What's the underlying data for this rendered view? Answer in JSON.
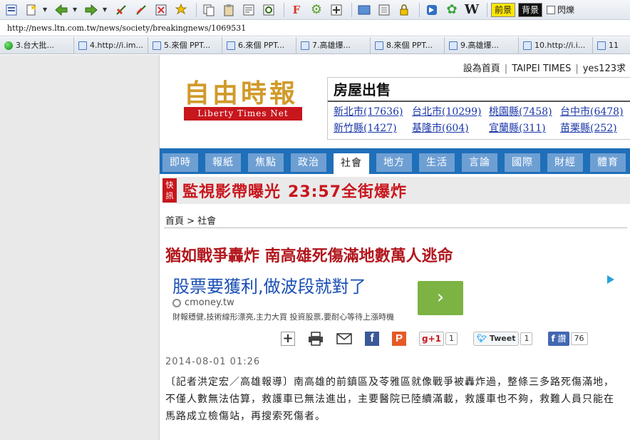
{
  "browser": {
    "toolbar_icons": [
      "home-icon",
      "new-page-icon",
      "back-icon",
      "forward-icon",
      "refresh-icon",
      "stop-icon",
      "close-tab-icon",
      "favorite-pin-icon",
      "copy-icon",
      "paste-icon",
      "edit-icon",
      "find-icon",
      "font-icon",
      "gear-icon",
      "move-icon",
      "window-icon",
      "download-icon",
      "lock-icon",
      "mail-icon",
      "flower-icon"
    ],
    "wiki_label": "W",
    "front_label": "前景",
    "back_label": "背景",
    "flash_label": "閃爍",
    "address": "http://news.ltn.com.tw/news/society/breakingnews/1069531",
    "tabs": [
      {
        "label": "3.台大批...",
        "icon": "green-dot"
      },
      {
        "label": "4.http://i.im...",
        "icon": "page"
      },
      {
        "label": "5.來個 PPT...",
        "icon": "page"
      },
      {
        "label": "6.來個 PPT...",
        "icon": "page"
      },
      {
        "label": "7.高雄爆...",
        "icon": "page"
      },
      {
        "label": "8.來個 PPT...",
        "icon": "page"
      },
      {
        "label": "9.高雄爆...",
        "icon": "page"
      },
      {
        "label": "10.http://i.i...",
        "icon": "page"
      },
      {
        "label": "11",
        "icon": "page"
      }
    ]
  },
  "site": {
    "top_links": [
      "設為首頁",
      "TAIPEI TIMES",
      "yes123求"
    ],
    "logo_cn": "自由時報",
    "logo_en": "Liberty Times Net",
    "house": {
      "title": "房屋出售",
      "links": [
        "新北市(17636)",
        "台北市(10299)",
        "桃園縣(7458)",
        "台中市(6478)",
        "新竹縣(1427)",
        "基隆市(604)",
        "宜蘭縣(311)",
        "苗栗縣(252)"
      ]
    },
    "nav": [
      "即時",
      "報紙",
      "焦點",
      "政治",
      "社會",
      "地方",
      "生活",
      "言論",
      "國際",
      "財經",
      "體育"
    ],
    "nav_active_index": 4,
    "breaking": {
      "tag": "快訊",
      "text_before": "監視影帶曝光",
      "time": "23:57",
      "text_after": "全街爆炸"
    },
    "breadcrumb": "首頁 > 社會",
    "headline": "猶如戰爭轟炸 南高雄死傷滿地數萬人逃命",
    "ad": {
      "title": "股票要獲利,做波段就對了",
      "site": "cmoney.tw",
      "desc": "財報穩健,技術線形漂亮,主力大買 投資股票,要耐心等待上漲時機",
      "button": "›"
    },
    "share": {
      "gplus_label": "g+1",
      "gplus_count": "1",
      "tweet_label": "Tweet",
      "tweet_count": "1",
      "like_label": "讚",
      "like_count": "76"
    },
    "date": "2014-08-01  01:26",
    "body": "〔記者洪定宏／高雄報導〕南高雄的前鎮區及苓雅區就像戰爭被轟炸過，整條三多路死傷滿地，不僅人數無法估算，救護車已無法進出，主要醫院已陸續滿載，救護車也不夠，救難人員只能在馬路成立檢傷站，再搜索死傷者。"
  }
}
